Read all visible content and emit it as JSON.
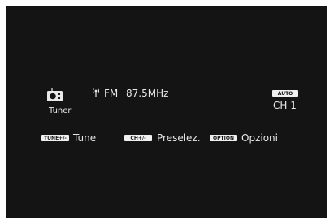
{
  "status": {
    "source_label": "Tuner",
    "band": "FM",
    "frequency": "87.5MHz",
    "mode_badge": "AUTO",
    "channel": "CH 1"
  },
  "controls": {
    "tune_key": "TUNE+/-",
    "tune_label": "Tune",
    "preset_key": "CH+/-",
    "preset_label": "Preselez.",
    "option_key": "OPTION",
    "option_label": "Opzioni"
  },
  "colors": {
    "screen_background": "#141414",
    "text": "#e8e8e8"
  },
  "icons": {
    "source": "radio-icon",
    "signal": "antenna-signal-icon"
  }
}
